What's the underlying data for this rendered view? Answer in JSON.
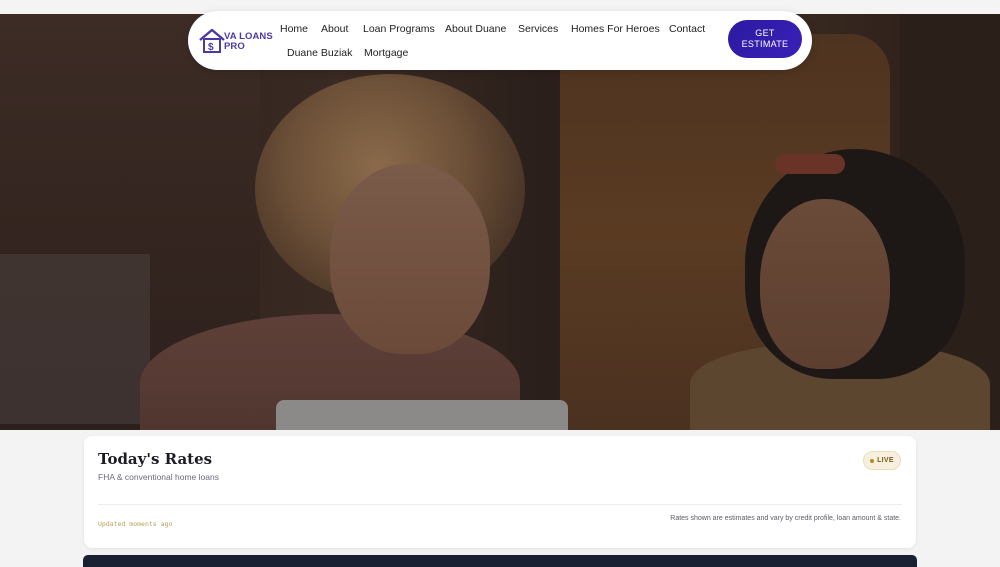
{
  "brand": {
    "name": "VA LOANS PRO",
    "line1": "VA LOANS",
    "line2": "PRO",
    "accent": "#4a3aa6"
  },
  "nav": {
    "links": [
      "Home",
      "About",
      "Loan Programs",
      "About Duane",
      "Services",
      "Homes For Heroes",
      "Contact",
      "Duane Buziak",
      "Mortgage"
    ],
    "cta_line1": "GET",
    "cta_line2": "ESTIMATE",
    "cta_color": "#2a1aa0"
  },
  "rates": {
    "title": "Today's Rates",
    "subtitle": "FHA & conventional home loans",
    "badge": "LIVE",
    "updated": "Updated moments ago",
    "disclaimer": "Rates shown are estimates and vary by credit profile, loan amount & state."
  }
}
